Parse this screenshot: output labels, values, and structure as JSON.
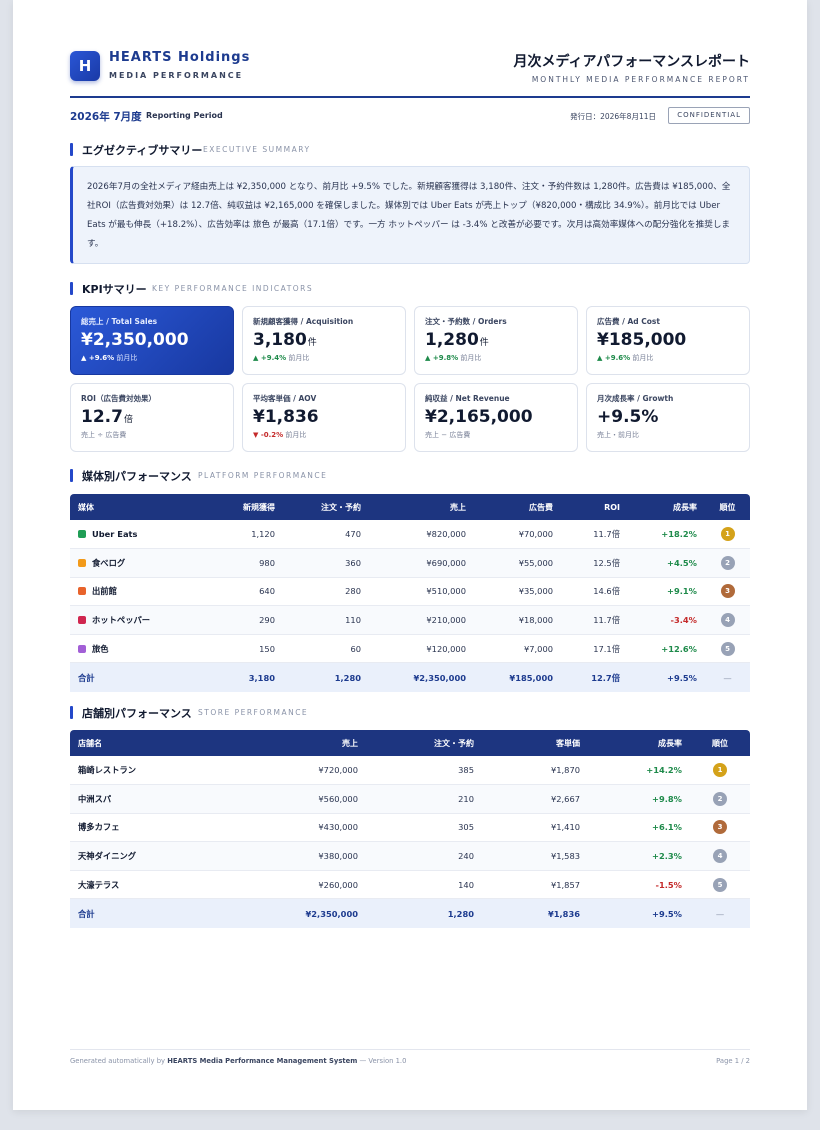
{
  "header": {
    "logo_letter": "H",
    "company": "HEARTS Holdings",
    "company_sub": "MEDIA PERFORMANCE",
    "title": "月次メディアパフォーマンスレポート",
    "subtitle": "MONTHLY MEDIA PERFORMANCE REPORT"
  },
  "meta": {
    "period": "2026年 7月度",
    "period_label": "Reporting Period",
    "issued": "発行日：2026年8月11日",
    "badge": "CONFIDENTIAL"
  },
  "summary": {
    "title": "エグゼクティブサマリー",
    "sub": "EXECUTIVE SUMMARY",
    "text": "2026年7月の全社メディア経由売上は ¥2,350,000 となり、前月比 +9.5% でした。新規顧客獲得は 3,180件、注文・予約件数は 1,280件。広告費は ¥185,000、全社ROI（広告費対効果）は 12.7倍、純収益は ¥2,165,000 を確保しました。媒体別では Uber Eats が売上トップ（¥820,000・構成比 34.9%）。前月比では Uber Eats が最も伸長（+18.2%）、広告効率は 旅色 が最高（17.1倍）です。一方 ホットペッパー は -3.4% と改善が必要です。次月は高効率媒体への配分強化を推奨します。"
  },
  "kpi": {
    "title": "KPIサマリー",
    "sub": "KEY PERFORMANCE INDICATORS",
    "cards": [
      {
        "label": "総売上 / Total Sales",
        "value": "¥2,350,000",
        "unit": "",
        "arrow": "▲",
        "delta": "+9.6%",
        "note": "前月比"
      },
      {
        "label": "新規顧客獲得 / Acquisition",
        "value": "3,180",
        "unit": "件",
        "arrow": "▲",
        "delta": "+9.4%",
        "note": "前月比"
      },
      {
        "label": "注文・予約数 / Orders",
        "value": "1,280",
        "unit": "件",
        "arrow": "▲",
        "delta": "+9.8%",
        "note": "前月比"
      },
      {
        "label": "広告費 / Ad Cost",
        "value": "¥185,000",
        "unit": "",
        "arrow": "▲",
        "delta": "+9.6%",
        "note": "前月比"
      },
      {
        "label": "ROI（広告費対効果）",
        "value": "12.7",
        "unit": "倍",
        "arrow": "",
        "delta": "",
        "note": "売上 ÷ 広告費"
      },
      {
        "label": "平均客単価 / AOV",
        "value": "¥1,836",
        "unit": "",
        "arrow": "▼",
        "delta": "-0.2%",
        "note": "前月比"
      },
      {
        "label": "純収益 / Net Revenue",
        "value": "¥2,165,000",
        "unit": "",
        "arrow": "",
        "delta": "",
        "note": "売上 − 広告費"
      },
      {
        "label": "月次成長率 / Growth",
        "value": "+9.5%",
        "unit": "",
        "arrow": "",
        "delta": "",
        "note": "売上・前月比"
      }
    ]
  },
  "platform": {
    "title": "媒体別パフォーマンス",
    "sub": "PLATFORM PERFORMANCE",
    "headers": [
      "媒体",
      "新規獲得",
      "注文・予約",
      "売上",
      "広告費",
      "ROI",
      "成長率",
      "順位"
    ],
    "rows": [
      {
        "color": "#1f9d55",
        "name": "Uber Eats",
        "acq": "1,120",
        "orders": "470",
        "sales": "¥820,000",
        "ad": "¥70,000",
        "roi": "11.7倍",
        "growth": "+18.2%",
        "rank": "1",
        "rank_color": "#d4a21a"
      },
      {
        "color": "#f29a1a",
        "name": "食べログ",
        "acq": "980",
        "orders": "360",
        "sales": "¥690,000",
        "ad": "¥55,000",
        "roi": "12.5倍",
        "growth": "+4.5%",
        "rank": "2",
        "rank_color": "#98a2b6"
      },
      {
        "color": "#e8632b",
        "name": "出前館",
        "acq": "640",
        "orders": "280",
        "sales": "¥510,000",
        "ad": "¥35,000",
        "roi": "14.6倍",
        "growth": "+9.1%",
        "rank": "3",
        "rank_color": "#b06a3a"
      },
      {
        "color": "#d0264f",
        "name": "ホットペッパー",
        "acq": "290",
        "orders": "110",
        "sales": "¥210,000",
        "ad": "¥18,000",
        "roi": "11.7倍",
        "growth": "-3.4%",
        "rank": "4",
        "rank_color": "#98a2b6"
      },
      {
        "color": "#a25fd6",
        "name": "旅色",
        "acq": "150",
        "orders": "60",
        "sales": "¥120,000",
        "ad": "¥7,000",
        "roi": "17.1倍",
        "growth": "+12.6%",
        "rank": "5",
        "rank_color": "#98a2b6"
      }
    ],
    "total": {
      "name": "合計",
      "acq": "3,180",
      "orders": "1,280",
      "sales": "¥2,350,000",
      "ad": "¥185,000",
      "roi": "12.7倍",
      "growth": "+9.5%",
      "rank": "—"
    }
  },
  "store": {
    "title": "店舗別パフォーマンス",
    "sub": "STORE PERFORMANCE",
    "headers": [
      "店舗名",
      "売上",
      "注文・予約",
      "客単価",
      "成長率",
      "順位"
    ],
    "rows": [
      {
        "name": "箱崎レストラン",
        "sales": "¥720,000",
        "orders": "385",
        "aov": "¥1,870",
        "growth": "+14.2%",
        "rank": "1",
        "rank_color": "#d4a21a"
      },
      {
        "name": "中洲スパ",
        "sales": "¥560,000",
        "orders": "210",
        "aov": "¥2,667",
        "growth": "+9.8%",
        "rank": "2",
        "rank_color": "#98a2b6"
      },
      {
        "name": "博多カフェ",
        "sales": "¥430,000",
        "orders": "305",
        "aov": "¥1,410",
        "growth": "+6.1%",
        "rank": "3",
        "rank_color": "#b06a3a"
      },
      {
        "name": "天神ダイニング",
        "sales": "¥380,000",
        "orders": "240",
        "aov": "¥1,583",
        "growth": "+2.3%",
        "rank": "4",
        "rank_color": "#98a2b6"
      },
      {
        "name": "大濠テラス",
        "sales": "¥260,000",
        "orders": "140",
        "aov": "¥1,857",
        "growth": "-1.5%",
        "rank": "5",
        "rank_color": "#98a2b6"
      }
    ],
    "total": {
      "name": "合計",
      "sales": "¥2,350,000",
      "orders": "1,280",
      "aov": "¥1,836",
      "growth": "+9.5%",
      "rank": "—"
    }
  },
  "footer": {
    "prefix": "Generated automatically by ",
    "system": "HEARTS Media Performance Management System",
    "suffix": " — Version 1.0",
    "page": "Page 1 / 2"
  }
}
